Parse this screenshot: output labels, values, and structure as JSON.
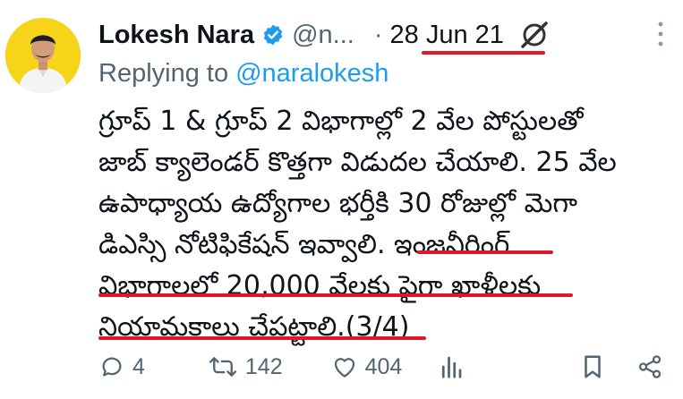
{
  "tweet": {
    "author_name": "Lokesh Nara",
    "author_handle": "@n...",
    "separator": "·",
    "date": "28 Jun 21",
    "reply_prefix": "Replying to",
    "reply_to": "@naralokesh",
    "text_lines": [
      "గ్రూప్ 1 & గ్రూప్ 2 విభాగాల్లో 2 వేల పోస్టులతో",
      "జాబ్ క్యాలెండర్ కొత్తగా విడుదల చేయాలి. 25 వేల",
      "ఉపాధ్యాయ ఉద్యోగాల భర్తీకి 30 రోజుల్లో మెగా",
      "డిఎస్సి నోటిఫికేషన్ ఇవ్వాలి. ఇంజనీరింగ్",
      "విభాగాలలో 20,000 వేలకు పైగా ఖాళీలకు",
      "నియామకాలు చేపట్టాలి.(3/4)"
    ]
  },
  "actions": {
    "replies": "4",
    "retweets": "142",
    "likes": "404"
  },
  "icons": [
    "verified-badge-icon",
    "grok-icon",
    "more-icon",
    "reply-icon",
    "retweet-icon",
    "like-icon",
    "views-icon",
    "bookmark-icon",
    "share-icon"
  ],
  "colors": {
    "accent": "#1d9bf0",
    "secondary_text": "#536471",
    "annotation_underline": "#e0172c",
    "avatar_background": "#f6d41a"
  }
}
